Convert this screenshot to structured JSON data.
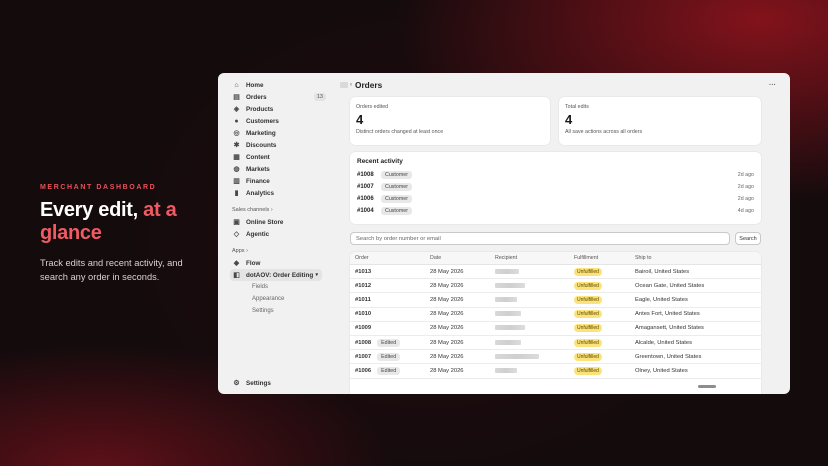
{
  "hero": {
    "eyebrow": "MERCHANT DASHBOARD",
    "headline_plain": "Every edit, ",
    "headline_accent": "at a glance",
    "description": "Track edits and recent activity, and search any order in seconds."
  },
  "sidebar": {
    "items": [
      {
        "label": "Home",
        "icon": "home-icon",
        "glyph": "⌂"
      },
      {
        "label": "Orders",
        "icon": "orders-icon",
        "glyph": "▤",
        "badge": "13"
      },
      {
        "label": "Products",
        "icon": "tag-icon",
        "glyph": "◈"
      },
      {
        "label": "Customers",
        "icon": "person-icon",
        "glyph": "●"
      },
      {
        "label": "Marketing",
        "icon": "target-icon",
        "glyph": "◎"
      },
      {
        "label": "Discounts",
        "icon": "discount-icon",
        "glyph": "✱"
      },
      {
        "label": "Content",
        "icon": "content-icon",
        "glyph": "▦"
      },
      {
        "label": "Markets",
        "icon": "globe-icon",
        "glyph": "◍"
      },
      {
        "label": "Finance",
        "icon": "bank-icon",
        "glyph": "▥"
      },
      {
        "label": "Analytics",
        "icon": "chart-icon",
        "glyph": "▮"
      }
    ],
    "sales_channels_label": "Sales channels",
    "channels": [
      {
        "label": "Online Store",
        "icon": "store-icon",
        "glyph": "▣"
      },
      {
        "label": "Agentic",
        "icon": "agentic-icon",
        "glyph": "◇"
      }
    ],
    "apps_label": "Apps",
    "apps": [
      {
        "label": "Flow",
        "icon": "flow-icon",
        "glyph": "◆"
      },
      {
        "label": "dotAOV: Order Editing",
        "icon": "app-icon",
        "glyph": "◧"
      }
    ],
    "app_subitems": [
      "Fields",
      "Appearance",
      "Settings"
    ],
    "settings_label": "Settings"
  },
  "header": {
    "title": "Orders",
    "more": "···"
  },
  "stats": [
    {
      "label": "Orders edited",
      "value": "4",
      "desc": "Distinct orders changed at least once"
    },
    {
      "label": "Total edits",
      "value": "4",
      "desc": "All save actions across all orders"
    }
  ],
  "recent_activity": {
    "title": "Recent activity",
    "rows": [
      {
        "order": "#1008",
        "tag": "Customer",
        "ago": "2d ago"
      },
      {
        "order": "#1007",
        "tag": "Customer",
        "ago": "2d ago"
      },
      {
        "order": "#1006",
        "tag": "Customer",
        "ago": "2d ago"
      },
      {
        "order": "#1004",
        "tag": "Customer",
        "ago": "4d ago"
      }
    ]
  },
  "search": {
    "placeholder": "Search by order number or email",
    "button": "Search"
  },
  "table": {
    "headers": [
      "Order",
      "Date",
      "Recipient",
      "Fulfillment",
      "Ship to"
    ],
    "rows": [
      {
        "order": "#1013",
        "edited": "",
        "date": "28 May 2026",
        "fulfillment": "Unfulfilled",
        "ship_to": "Bairoil, United States"
      },
      {
        "order": "#1012",
        "edited": "",
        "date": "28 May 2026",
        "fulfillment": "Unfulfilled",
        "ship_to": "Ocean Gate, United States"
      },
      {
        "order": "#1011",
        "edited": "",
        "date": "28 May 2026",
        "fulfillment": "Unfulfilled",
        "ship_to": "Eagle, United States"
      },
      {
        "order": "#1010",
        "edited": "",
        "date": "28 May 2026",
        "fulfillment": "Unfulfilled",
        "ship_to": "Antes Fort, United States"
      },
      {
        "order": "#1009",
        "edited": "",
        "date": "28 May 2026",
        "fulfillment": "Unfulfilled",
        "ship_to": "Amagansett, United States"
      },
      {
        "order": "#1008",
        "edited": "Edited",
        "date": "28 May 2026",
        "fulfillment": "Unfulfilled",
        "ship_to": "Alcalde, United States"
      },
      {
        "order": "#1007",
        "edited": "Edited",
        "date": "28 May 2026",
        "fulfillment": "Unfulfilled",
        "ship_to": "Greentown, United States"
      },
      {
        "order": "#1006",
        "edited": "Edited",
        "date": "28 May 2026",
        "fulfillment": "Unfulfilled",
        "ship_to": "Olney, United States"
      }
    ]
  },
  "colors": {
    "accent": "#ef5a63",
    "fulfillment_badge": "#fbe27a"
  }
}
